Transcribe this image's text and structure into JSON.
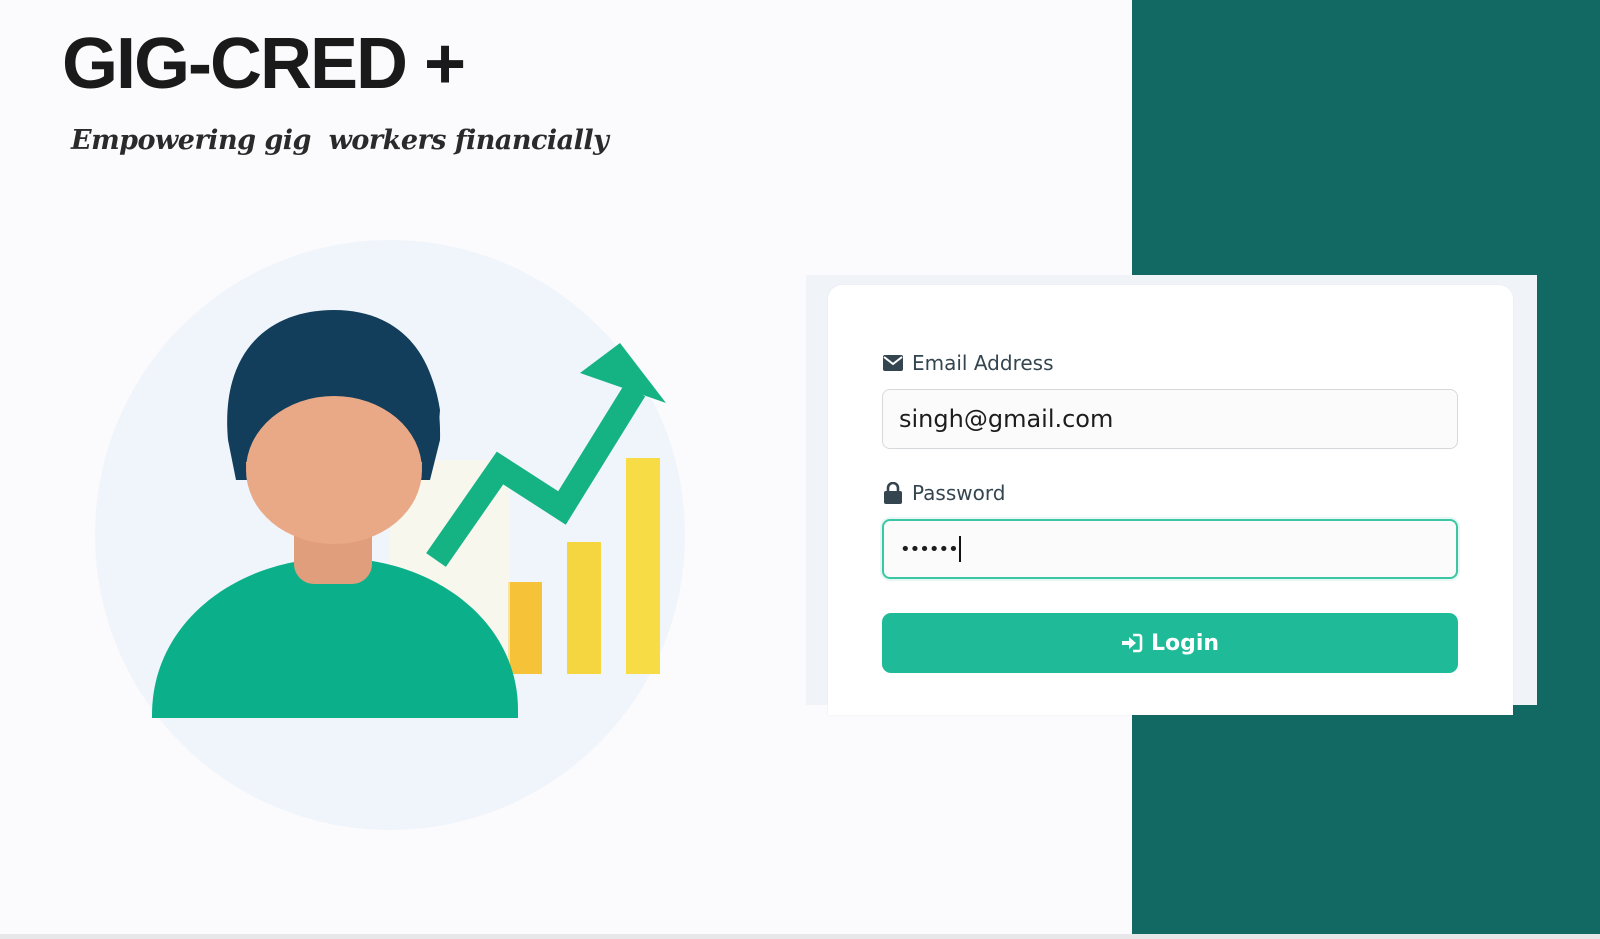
{
  "brand": {
    "title": "GIG-CRED +",
    "tagline": "Empowering gig  workers financially"
  },
  "login_form": {
    "email": {
      "label": "Email Address",
      "value": "singh@gmail.com",
      "icon": "envelope-icon"
    },
    "password": {
      "label": "Password",
      "value": "••••••",
      "icon": "lock-icon"
    },
    "submit": {
      "label": "Login",
      "icon": "sign-in-icon"
    }
  },
  "colors": {
    "panel_green": "#126963",
    "accent_teal": "#1fba98",
    "person_shirt": "#0bb08a",
    "person_hair": "#123e5c",
    "person_skin": "#eaa986",
    "bar_yellow": "#f6d640",
    "page_background": "#fbfafc"
  }
}
